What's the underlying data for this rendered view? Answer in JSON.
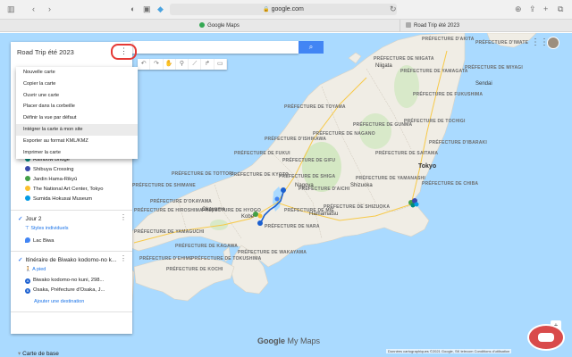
{
  "browser": {
    "address": "google.com",
    "tabs": [
      "Google Maps",
      "Road Trip été 2023"
    ]
  },
  "panel": {
    "title": "Road Trip été 2023",
    "menu": [
      "Nouvelle carte",
      "Copier la carte",
      "Ouvrir une carte",
      "Placer dans la corbeille",
      "Définir la vue par défaut",
      "Intégrer la carte à mon site",
      "Exporter au format KML/KMZ",
      "Imprimer la carte"
    ],
    "places_day1": [
      "Rainbow Bridge",
      "Shibuya Crossing",
      "Jardin Hama-Rikyū",
      "The National Art Center, Tokyo",
      "Sumida Hokusai Museum"
    ],
    "layer2": {
      "title": "Jour 2",
      "style": "Styles individuels",
      "place": "Lac Biwa"
    },
    "layer3": {
      "title": "Itinéraire de Biwako kodomo-no k...",
      "mode": "A pied",
      "a": "Biwako kodomo-no kuni, 298...",
      "b": "Osaka, Préfecture d'Osaka, J...",
      "add": "Ajouter une destination"
    },
    "basemap": "Carte de base"
  },
  "map_labels": {
    "prefectures": [
      "PRÉFECTURE DE NIIGATA",
      "PRÉFECTURE DE FUKUSHIMA",
      "PRÉFECTURE DE TOCHIGI",
      "PRÉFECTURE D'IBARAKI",
      "PRÉFECTURE DE GUNMA",
      "PRÉFECTURE DE SAITAMA",
      "PRÉFECTURE DE CHIBA",
      "PRÉFECTURE DE NAGANO",
      "PRÉFECTURE DE TOYAMA",
      "PRÉFECTURE DE GIFU",
      "PRÉFECTURE DE FUKUI",
      "PRÉFECTURE DE SHIGA",
      "PRÉFECTURE DE KYOTO",
      "PRÉFECTURE D'AICHI",
      "PRÉFECTURE DE SHIZUOKA",
      "PRÉFECTURE DE NARA",
      "PRÉFECTURE DE MIE",
      "PRÉFECTURE DE WAKAYAMA",
      "PRÉFECTURE DE TOTTORI",
      "PRÉFECTURE DE SHIMANE",
      "PRÉFECTURE D'OKAYAMA",
      "PRÉFECTURE DE HIROSHIMA",
      "PRÉFECTURE DE YAMAGUCHI",
      "PRÉFECTURE DE KAGAWA",
      "PRÉFECTURE DE TOKUSHIMA",
      "PRÉFECTURE D'EHIME",
      "PRÉFECTURE DE KOCHI",
      "PRÉFECTURE DE YAMANASHI",
      "PRÉFECTURE DE MIYAGI",
      "PRÉFECTURE DE YAMAGATA",
      "PRÉFECTURE D'AKITA",
      "PRÉFECTURE D'IWATE",
      "PRÉFECTURE DE HYOGO",
      "PRÉFECTURE D'ISHIKAWA"
    ],
    "cities": [
      "Sendai",
      "Okayama",
      "Kobe",
      "Hamamatsu",
      "Shizuoka",
      "Nagoya",
      "Niigata",
      "Tokyo"
    ]
  },
  "footer": {
    "logo_google": "Google",
    "logo_mymaps": "My Maps",
    "attribution": "Données cartographiques ©2021 Google, SK telecom   Conditions d'utilisation"
  },
  "colors": {
    "land": "#f0ede5",
    "sea": "#aadaff",
    "accent": "#4285f4",
    "route": "#1a5fd0",
    "highlight": "#e53935",
    "park": "#c8e6b5"
  }
}
